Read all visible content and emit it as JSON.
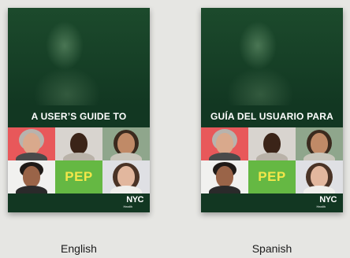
{
  "covers": [
    {
      "title": "A USER’S GUIDE TO",
      "center_label": "PEP",
      "brand": "NYC",
      "brand_sub": "Health",
      "caption": "English"
    },
    {
      "title": "GUÍA DEL USUARIO PARA",
      "center_label": "PEP",
      "brand": "NYC",
      "brand_sub": "Health",
      "caption": "Spanish"
    }
  ],
  "colors": {
    "cover_green": "#123722",
    "pep_tile_green": "#65b843",
    "pep_text_yellow": "#f3e64a",
    "background": "#e6e6e3"
  }
}
